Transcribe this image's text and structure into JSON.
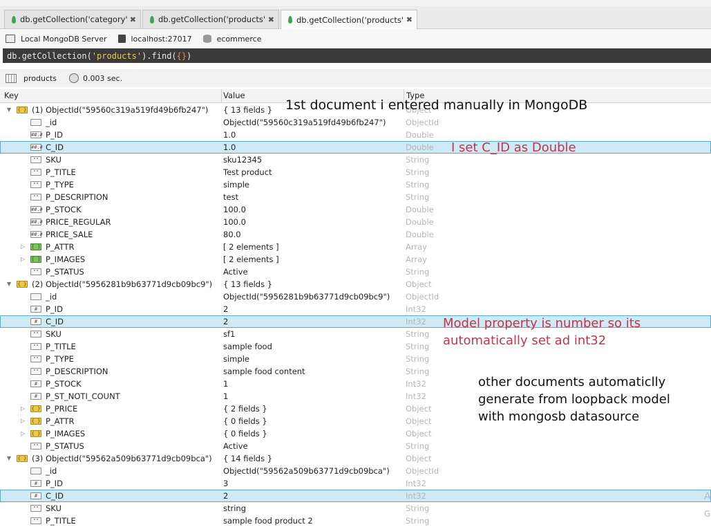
{
  "tabs": [
    {
      "label": "db.getCollection('category').fin...",
      "close": "✖"
    },
    {
      "label": "db.getCollection('products').fi...",
      "close": "✖"
    },
    {
      "label": "db.getCollection('products').find...",
      "close": "✖"
    }
  ],
  "connection": {
    "server": "Local MongoDB Server",
    "host": "localhost:27017",
    "database": "ecommerce"
  },
  "query": {
    "prefix": "db.getCollection(",
    "collection": "'products'",
    "middle": ").find(",
    "args": "{}",
    "suffix": ")"
  },
  "result": {
    "collection": "products",
    "time": "0.003 sec."
  },
  "columns": {
    "key": "Key",
    "value": "Value",
    "type": "Type"
  },
  "rows": [
    {
      "level": 0,
      "expand": "▼",
      "icon": "object",
      "key": "(1) ObjectId(\"59560c319a519fd49b6fb247\")",
      "value": "{ 13 fields }",
      "type": "Object"
    },
    {
      "level": 1,
      "expand": "",
      "icon": "oid",
      "key": "_id",
      "value": "ObjectId(\"59560c319a519fd49b6fb247\")",
      "type": "ObjectId"
    },
    {
      "level": 1,
      "expand": "",
      "icon": "number",
      "key": "P_ID",
      "value": "1.0",
      "type": "Double"
    },
    {
      "level": 1,
      "expand": "",
      "icon": "number",
      "key": "C_ID",
      "value": "1.0",
      "type": "Double",
      "selected": true
    },
    {
      "level": 1,
      "expand": "",
      "icon": "string",
      "key": "SKU",
      "value": "sku12345",
      "type": "String"
    },
    {
      "level": 1,
      "expand": "",
      "icon": "string",
      "key": "P_TITLE",
      "value": "Test product",
      "type": "String"
    },
    {
      "level": 1,
      "expand": "",
      "icon": "string",
      "key": "P_TYPE",
      "value": "simple",
      "type": "String"
    },
    {
      "level": 1,
      "expand": "",
      "icon": "string",
      "key": "P_DESCRIPTION",
      "value": "test",
      "type": "String"
    },
    {
      "level": 1,
      "expand": "",
      "icon": "number",
      "key": "P_STOCK",
      "value": "100.0",
      "type": "Double"
    },
    {
      "level": 1,
      "expand": "",
      "icon": "number",
      "key": "PRICE_REGULAR",
      "value": "100.0",
      "type": "Double"
    },
    {
      "level": 1,
      "expand": "",
      "icon": "number",
      "key": "PRICE_SALE",
      "value": "80.0",
      "type": "Double"
    },
    {
      "level": 1,
      "expand": "▷",
      "icon": "array",
      "key": "P_ATTR",
      "value": "[ 2 elements ]",
      "type": "Array"
    },
    {
      "level": 1,
      "expand": "▷",
      "icon": "array",
      "key": "P_IMAGES",
      "value": "[ 2 elements ]",
      "type": "Array"
    },
    {
      "level": 1,
      "expand": "",
      "icon": "string",
      "key": "P_STATUS",
      "value": "Active",
      "type": "String"
    },
    {
      "level": 0,
      "expand": "▼",
      "icon": "object",
      "key": "(2) ObjectId(\"5956281b9b63771d9cb09bc9\")",
      "value": "{ 13 fields }",
      "type": "Object"
    },
    {
      "level": 1,
      "expand": "",
      "icon": "oid",
      "key": "_id",
      "value": "ObjectId(\"5956281b9b63771d9cb09bc9\")",
      "type": "ObjectId"
    },
    {
      "level": 1,
      "expand": "",
      "icon": "int",
      "key": "P_ID",
      "value": "2",
      "type": "Int32"
    },
    {
      "level": 1,
      "expand": "",
      "icon": "int",
      "key": "C_ID",
      "value": "2",
      "type": "Int32",
      "selected": true
    },
    {
      "level": 1,
      "expand": "",
      "icon": "string",
      "key": "SKU",
      "value": "sf1",
      "type": "String"
    },
    {
      "level": 1,
      "expand": "",
      "icon": "string",
      "key": "P_TITLE",
      "value": "sample food",
      "type": "String"
    },
    {
      "level": 1,
      "expand": "",
      "icon": "string",
      "key": "P_TYPE",
      "value": "simple",
      "type": "String"
    },
    {
      "level": 1,
      "expand": "",
      "icon": "string",
      "key": "P_DESCRIPTION",
      "value": "sample food content",
      "type": "String"
    },
    {
      "level": 1,
      "expand": "",
      "icon": "int",
      "key": "P_STOCK",
      "value": "1",
      "type": "Int32"
    },
    {
      "level": 1,
      "expand": "",
      "icon": "int",
      "key": "P_ST_NOTI_COUNT",
      "value": "1",
      "type": "Int32"
    },
    {
      "level": 1,
      "expand": "▷",
      "icon": "object",
      "key": "P_PRICE",
      "value": "{ 2 fields }",
      "type": "Object"
    },
    {
      "level": 1,
      "expand": "▷",
      "icon": "object",
      "key": "P_ATTR",
      "value": "{ 0 fields }",
      "type": "Object"
    },
    {
      "level": 1,
      "expand": "▷",
      "icon": "object",
      "key": "P_IMAGES",
      "value": "{ 0 fields }",
      "type": "Object"
    },
    {
      "level": 1,
      "expand": "",
      "icon": "string",
      "key": "P_STATUS",
      "value": "Active",
      "type": "String"
    },
    {
      "level": 0,
      "expand": "▼",
      "icon": "object",
      "key": "(3) ObjectId(\"59562a509b63771d9cb09bca\")",
      "value": "{ 14 fields }",
      "type": "Object"
    },
    {
      "level": 1,
      "expand": "",
      "icon": "oid",
      "key": "_id",
      "value": "ObjectId(\"59562a509b63771d9cb09bca\")",
      "type": "ObjectId"
    },
    {
      "level": 1,
      "expand": "",
      "icon": "int",
      "key": "P_ID",
      "value": "3",
      "type": "Int32"
    },
    {
      "level": 1,
      "expand": "",
      "icon": "int",
      "key": "C_ID",
      "value": "2",
      "type": "Int32",
      "selected": true
    },
    {
      "level": 1,
      "expand": "",
      "icon": "string",
      "key": "SKU",
      "value": "string",
      "type": "String"
    },
    {
      "level": 1,
      "expand": "",
      "icon": "string",
      "key": "P_TITLE",
      "value": "sample food product 2",
      "type": "String"
    }
  ],
  "annotations": {
    "first_doc": "1st document i entered manually in MongoDB",
    "double_note": "I set C_ID as Double",
    "model_note_line1": "Model property is number so its",
    "model_note_line2": "automatically set ad int32",
    "other_line1": "other documents automaticlly",
    "other_line2": "generate from loopback model",
    "other_line3": "with mongosb datasource"
  },
  "edge_text": {
    "a": "A",
    "g": "G"
  },
  "colors": {
    "selection": "#cfe9f5",
    "annotation_red": "#c4344a",
    "query_bg": "#3a3a3a"
  }
}
